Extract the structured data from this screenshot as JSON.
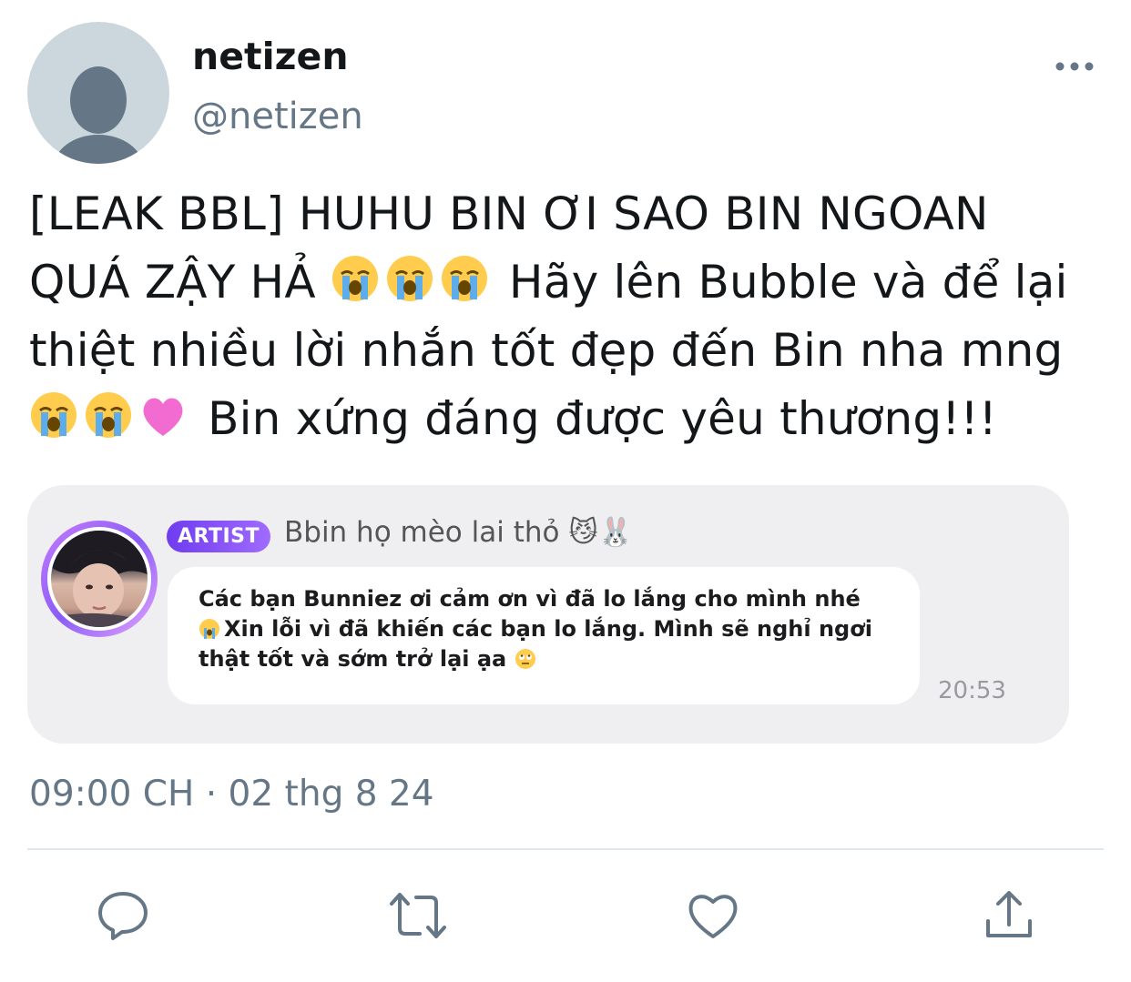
{
  "user": {
    "display_name": "netizen",
    "handle": "@netizen",
    "avatar_icon": "default-person-icon"
  },
  "tweet": {
    "lines": [
      "[LEAK BBL] HUHU BIN ƠI SAO BIN NGOAN",
      " Hãy lên Bubble và để lại",
      "thiệt nhiều lời nhắn tốt đẹp đến Bin nha mng",
      " Bin xứng đáng được yêu thương!!!"
    ],
    "line2_prefix": "QUÁ ZẬY HẢ ",
    "emoji": [
      "loudly-crying-face-icon",
      "heart-pink-icon"
    ]
  },
  "quote": {
    "badge": "ARTIST",
    "artist_name": "Bbin họ mèo lai thỏ 😼🐰",
    "message_lines": [
      "Các bạn Bunniez ơi cảm ơn vì đã lo lắng cho mình nhé",
      "Xin lỗi vì đã khiến các bạn lo lắng. Mình sẽ nghỉ ngơi",
      "thật tốt và sớm trở lại ạa"
    ],
    "time": "20:53"
  },
  "timestamp": "09:00 CH · 02 thg 8 24",
  "actions": [
    "reply-icon",
    "retweet-icon",
    "like-icon",
    "share-icon"
  ],
  "colors": {
    "text": "#14171a",
    "secondary": "#657786",
    "badge": "#7b4cf5",
    "card": "#efeff1"
  }
}
